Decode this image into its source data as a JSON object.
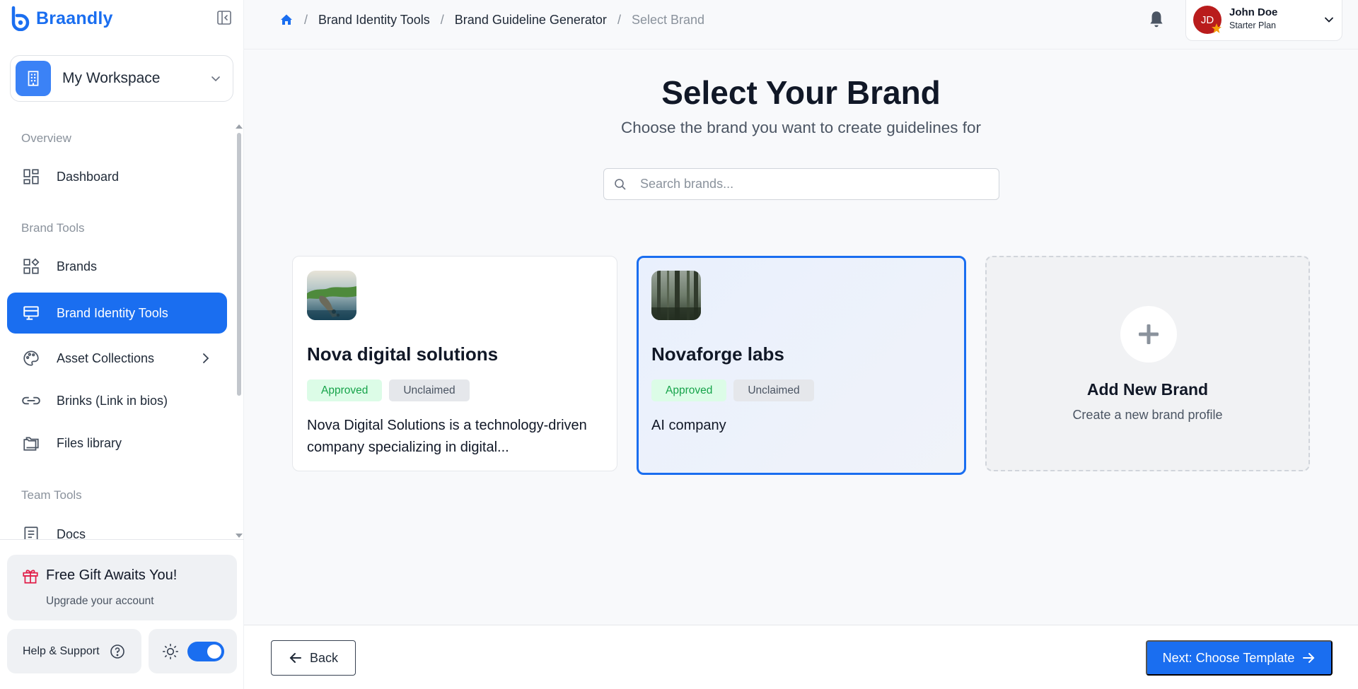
{
  "app": {
    "name": "Braandly"
  },
  "sidebar": {
    "workspace": {
      "label": "My Workspace"
    },
    "sections": {
      "overview": "Overview",
      "brand_tools": "Brand Tools",
      "team_tools": "Team Tools"
    },
    "items": {
      "dashboard": "Dashboard",
      "brands": "Brands",
      "brand_identity_tools": "Brand Identity Tools",
      "asset_collections": "Asset Collections",
      "brinks": "Brinks (Link in bios)",
      "files_library": "Files library",
      "docs": "Docs"
    },
    "active_item": "Brand Identity Tools",
    "gift": {
      "title": "Free Gift Awaits You!",
      "subtitle": "Upgrade your account"
    },
    "help_label": "Help & Support",
    "theme_toggle_on": true
  },
  "header": {
    "breadcrumb": [
      "Brand Identity Tools",
      "Brand Guideline Generator",
      "Select Brand"
    ],
    "user": {
      "initials": "JD",
      "name": "John Doe",
      "plan": "Starter Plan"
    }
  },
  "main": {
    "title": "Select Your Brand",
    "subtitle": "Choose the brand you want to create guidelines for",
    "search": {
      "placeholder": "Search brands...",
      "value": ""
    },
    "brands": [
      {
        "name": "Nova digital solutions",
        "badges": [
          "Approved",
          "Unclaimed"
        ],
        "description": "Nova Digital Solutions is a technology-driven company specializing in digital...",
        "selected": false
      },
      {
        "name": "Novaforge labs",
        "badges": [
          "Approved",
          "Unclaimed"
        ],
        "description": "AI company",
        "selected": true
      }
    ],
    "add_new": {
      "title": "Add New Brand",
      "subtitle": "Create a new brand profile"
    }
  },
  "footer": {
    "back_label": "Back",
    "next_label": "Next: Choose Template"
  },
  "colors": {
    "accent": "#1a6ef0",
    "approved_bg": "#dcfce7",
    "approved_text": "#16a34a",
    "unclaimed_bg": "#e5e7eb",
    "avatar": "#b91c1c"
  }
}
